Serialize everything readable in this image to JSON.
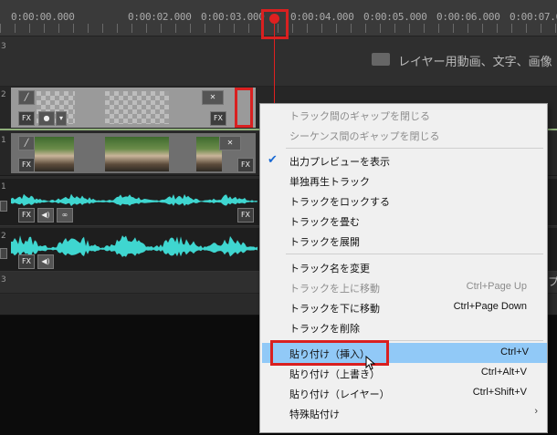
{
  "ruler": {
    "timecodes": [
      "0:00:00.000",
      "0:00:02.000",
      "0:00:03.000",
      "0:00:04.000",
      "0:00:05.000",
      "0:00:06.000",
      "0:00:07.000"
    ]
  },
  "tracks": {
    "n3a": "3",
    "n2": "2",
    "n1": "1",
    "a1": "1",
    "a2": "2",
    "n3b": "3",
    "layer_hint": "レイヤー用動画、文字、画像",
    "bottom_hint": "プ"
  },
  "icons": {
    "fx": "FX"
  },
  "menu": {
    "items": [
      {
        "label": "トラック間のギャップを閉じる",
        "shortcut": "",
        "disabled": true
      },
      {
        "label": "シーケンス間のギャップを閉じる",
        "shortcut": "",
        "disabled": true
      },
      {
        "label": "出力プレビューを表示",
        "shortcut": "",
        "checked": true
      },
      {
        "label": "単独再生トラック",
        "shortcut": ""
      },
      {
        "label": "トラックをロックする",
        "shortcut": ""
      },
      {
        "label": "トラックを畳む",
        "shortcut": ""
      },
      {
        "label": "トラックを展開",
        "shortcut": ""
      },
      {
        "label": "トラック名を変更",
        "shortcut": ""
      },
      {
        "label": "トラックを上に移動",
        "shortcut": "Ctrl+Page Up",
        "disabled": true
      },
      {
        "label": "トラックを下に移動",
        "shortcut": "Ctrl+Page Down"
      },
      {
        "label": "トラックを削除",
        "shortcut": ""
      },
      {
        "label": "貼り付け（挿入）",
        "shortcut": "Ctrl+V",
        "highlighted": true
      },
      {
        "label": "貼り付け（上書き）",
        "shortcut": "Ctrl+Alt+V"
      },
      {
        "label": "貼り付け（レイヤー）",
        "shortcut": "Ctrl+Shift+V"
      },
      {
        "label": "特殊貼付け",
        "shortcut": "",
        "submenu": true
      }
    ]
  },
  "colors": {
    "highlight": "#91c9f7",
    "annotation": "#d92020",
    "waveform": "#3fd6d0",
    "playhead": "#e02020"
  }
}
